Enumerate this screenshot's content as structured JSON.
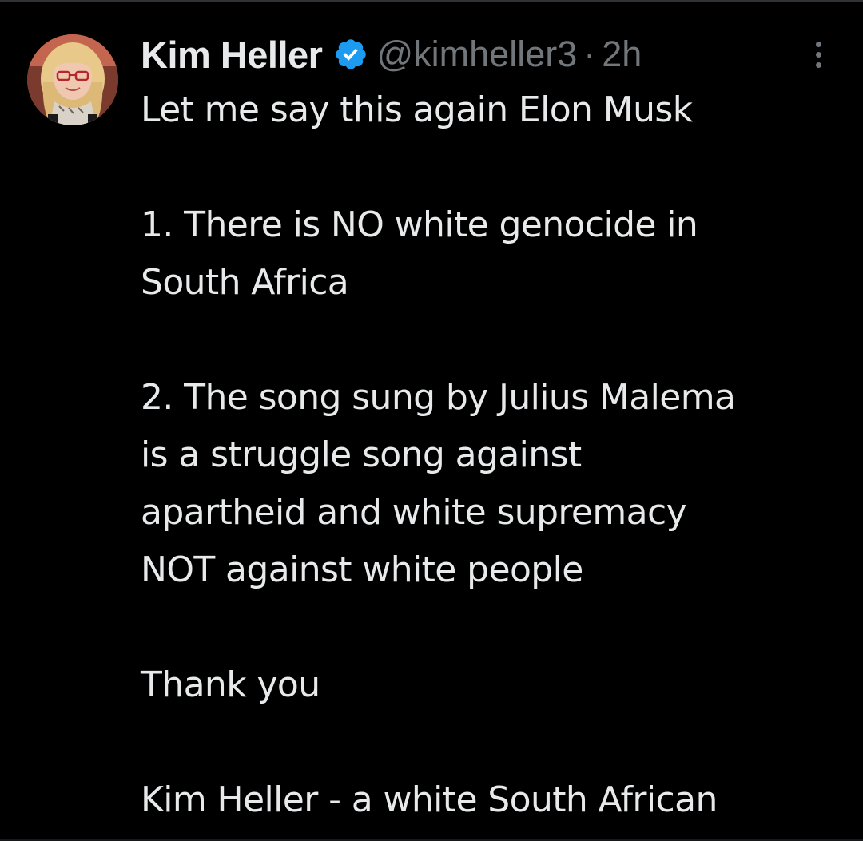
{
  "tweet": {
    "author": {
      "display_name": "Kim Heller",
      "verified_icon": "verified-badge-icon",
      "handle": "@kimheller3",
      "separator": "·",
      "time_ago": "2h"
    },
    "menu_icon": "more-options-icon",
    "body": {
      "line1": "Let me say this again Elon Musk",
      "line2": "1. There is NO white genocide in",
      "line3": "South Africa",
      "line4": "2. The song sung by Julius Malema",
      "line5": "is a struggle song against",
      "line6": "apartheid and white supremacy",
      "line7": "NOT against white people",
      "line8": "Thank you",
      "line9": "Kim Heller - a white South African"
    }
  },
  "colors": {
    "background": "#000000",
    "text_primary": "#e7e9ea",
    "text_secondary": "#71767b",
    "verified_blue": "#1d9bf0",
    "divider": "#2f3336"
  }
}
